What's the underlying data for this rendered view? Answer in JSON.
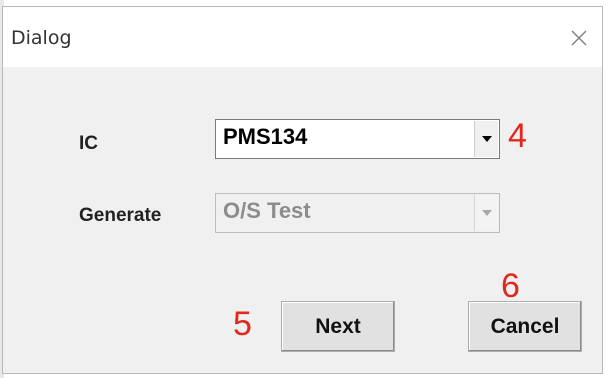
{
  "window": {
    "title": "Dialog",
    "close_glyph": "×"
  },
  "form": {
    "ic_label": "IC",
    "ic_value": "PMS134",
    "generate_label": "Generate",
    "generate_value": "O/S Test"
  },
  "buttons": {
    "next_label": "Next",
    "cancel_label": "Cancel"
  },
  "annotations": {
    "ic_dropdown_marker": "4",
    "next_marker": "5",
    "cancel_marker": "6",
    "color": "#e0281c"
  },
  "icons": {
    "close": "close-icon",
    "dropdown": "chevron-down-icon"
  }
}
